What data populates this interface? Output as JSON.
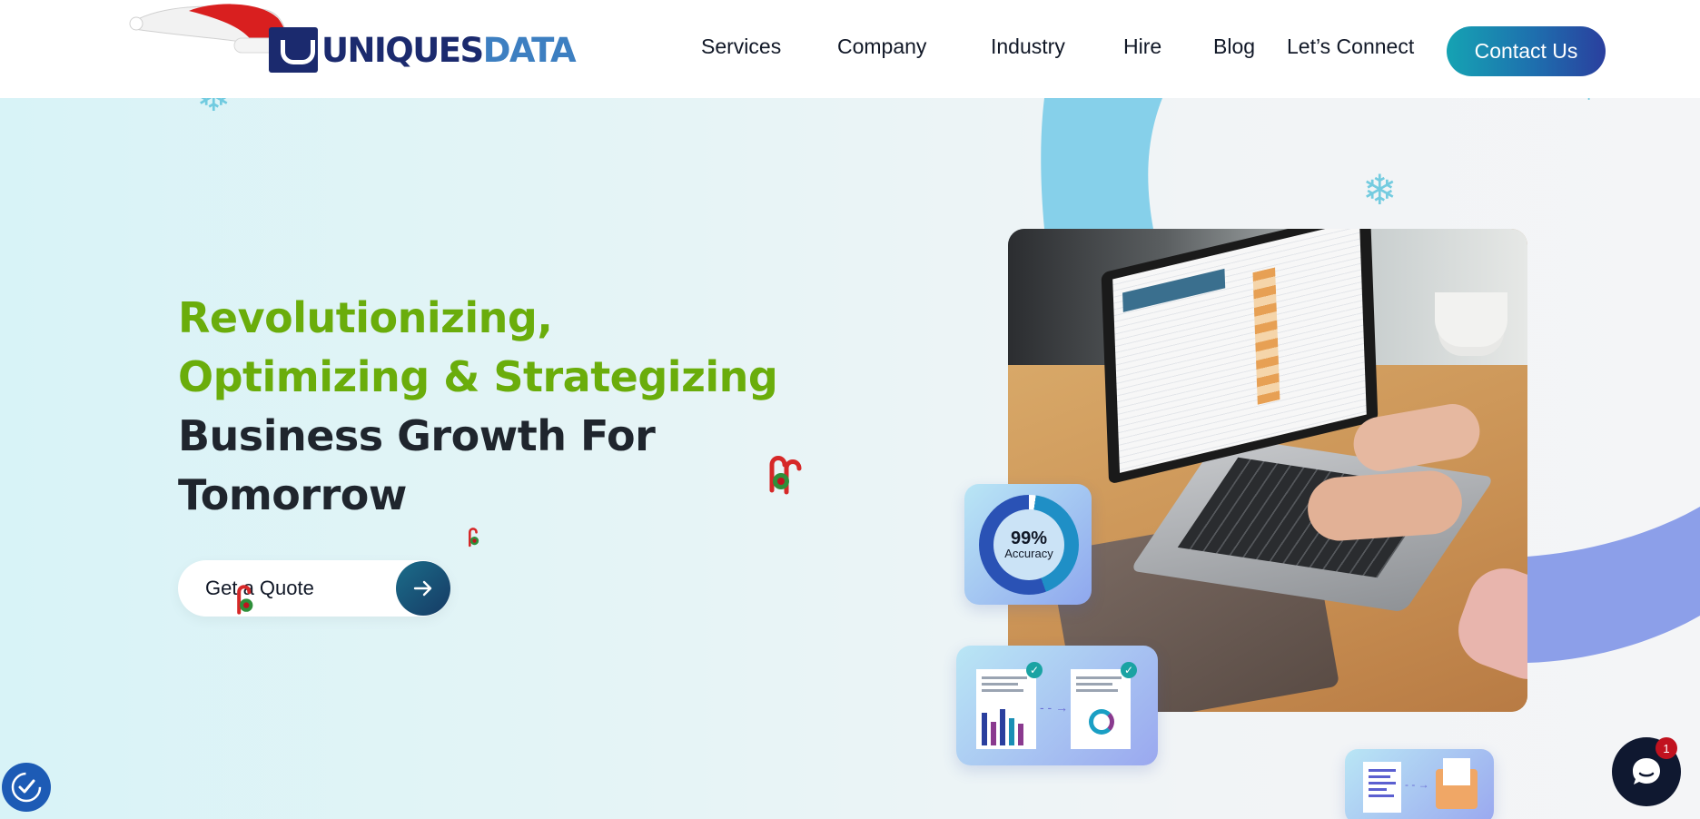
{
  "header": {
    "logo": {
      "part1": "UNIQUES",
      "part2": "DATA"
    },
    "nav": [
      {
        "label": "Services"
      },
      {
        "label": "Company"
      },
      {
        "label": "Industry"
      },
      {
        "label": "Hire"
      },
      {
        "label": "Blog"
      },
      {
        "label": "Let’s Connect"
      }
    ],
    "contact_label": "Contact Us"
  },
  "hero": {
    "headline": {
      "line1": "Revolutionizing,",
      "line2": "Optimizing & Strategizing",
      "line3": "Business Growth For",
      "line4": "Tomorrow"
    },
    "quote_label": "Get a Quote",
    "accuracy": {
      "value": "99%",
      "label": "Accuracy"
    }
  },
  "widgets": {
    "chat_badge": "1"
  },
  "colors": {
    "headline_green": "#6aad0b",
    "headline_dark": "#1f252d",
    "brand_navy": "#1b2a6e",
    "brand_blue": "#3d7fc1",
    "contact_gradient_start": "#15a3b3",
    "contact_gradient_end": "#2a3f9e"
  },
  "icons": [
    "santa-hat-icon",
    "snowflake-icon",
    "candy-cane-icon",
    "arrow-right-icon",
    "accessibility-icon",
    "chat-icon",
    "check-icon"
  ]
}
